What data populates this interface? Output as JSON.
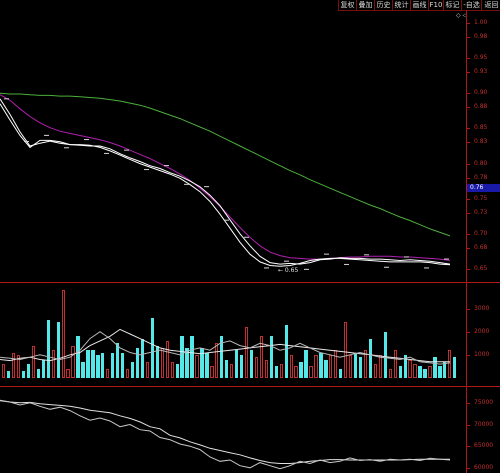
{
  "toolbar": {
    "buttons": [
      "复权",
      "叠加",
      "历史",
      "统计",
      "画线",
      "F10",
      "标记",
      "-自选",
      "返回"
    ]
  },
  "top_right_glyph": "◇ ◁",
  "price_marker": "0.76",
  "low_annotation": "← 0.65",
  "colors": {
    "background": "#000000",
    "frame": "#b01818",
    "up_bar": "#c03030",
    "down_bar": "#54e8e8",
    "ma_long": "#4caf3a",
    "ma_mid": "#b020b0",
    "ma_short": "#ffffff",
    "marker_bg": "#1a1aa8"
  },
  "chart_data": [
    {
      "type": "line",
      "panel": "price",
      "yticks": [
        "1.00",
        "0.98",
        "0.95",
        "0.93",
        "0.90",
        "0.88",
        "0.85",
        "0.83",
        "0.80",
        "0.78",
        "0.75",
        "0.73",
        "0.70",
        "0.68",
        "0.65"
      ],
      "ylim": [
        0.64,
        1.01
      ],
      "x": [
        0,
        10,
        20,
        30,
        40,
        50,
        60,
        70,
        80,
        90,
        100,
        110,
        120,
        130,
        140,
        150,
        160,
        170,
        180,
        190,
        200,
        210,
        220,
        230,
        240,
        250,
        260,
        270,
        280,
        290,
        300,
        310,
        320,
        330,
        340,
        350,
        360,
        370,
        380,
        390,
        400,
        410,
        420,
        430,
        440,
        450
      ],
      "series": [
        {
          "values": [
            0.9,
            0.899,
            0.899,
            0.898,
            0.897,
            0.897,
            0.896,
            0.896,
            0.895,
            0.894,
            0.893,
            0.891,
            0.889,
            0.886,
            0.883,
            0.879,
            0.874,
            0.869,
            0.864,
            0.858,
            0.852,
            0.846,
            0.839,
            0.832,
            0.825,
            0.818,
            0.811,
            0.804,
            0.797,
            0.79,
            0.784,
            0.777,
            0.771,
            0.765,
            0.759,
            0.753,
            0.747,
            0.741,
            0.736,
            0.73,
            0.724,
            0.719,
            0.713,
            0.707,
            0.702,
            0.697
          ]
        },
        {
          "values": [
            0.898,
            0.89,
            0.878,
            0.867,
            0.858,
            0.851,
            0.846,
            0.843,
            0.84,
            0.837,
            0.834,
            0.83,
            0.825,
            0.819,
            0.813,
            0.807,
            0.8,
            0.793,
            0.785,
            0.776,
            0.765,
            0.753,
            0.739,
            0.724,
            0.709,
            0.695,
            0.683,
            0.674,
            0.669,
            0.666,
            0.665,
            0.664,
            0.664,
            0.665,
            0.666,
            0.667,
            0.667,
            0.668,
            0.668,
            0.668,
            0.667,
            0.667,
            0.666,
            0.665,
            0.664,
            0.662
          ]
        },
        {
          "values": [
            0.892,
            0.87,
            0.845,
            0.825,
            0.829,
            0.832,
            0.829,
            0.827,
            0.826,
            0.825,
            0.825,
            0.821,
            0.814,
            0.808,
            0.803,
            0.797,
            0.793,
            0.787,
            0.782,
            0.775,
            0.767,
            0.755,
            0.74,
            0.72,
            0.7,
            0.683,
            0.668,
            0.659,
            0.657,
            0.658,
            0.657,
            0.659,
            0.663,
            0.664,
            0.666,
            0.665,
            0.665,
            0.664,
            0.664,
            0.663,
            0.662,
            0.663,
            0.662,
            0.661,
            0.659,
            0.657
          ]
        },
        {
          "values": [
            0.885,
            0.862,
            0.84,
            0.823,
            0.833,
            0.833,
            0.831,
            0.827,
            0.827,
            0.826,
            0.823,
            0.818,
            0.812,
            0.806,
            0.8,
            0.795,
            0.79,
            0.785,
            0.779,
            0.77,
            0.76,
            0.746,
            0.728,
            0.708,
            0.688,
            0.671,
            0.66,
            0.655,
            0.654,
            0.655,
            0.658,
            0.662,
            0.664,
            0.665,
            0.665,
            0.664,
            0.663,
            0.662,
            0.661,
            0.66,
            0.66,
            0.66,
            0.66,
            0.659,
            0.657,
            0.656
          ]
        }
      ]
    },
    {
      "type": "bar",
      "panel": "volume",
      "yticks": [
        "3000",
        "2000",
        "1000"
      ],
      "ylim": [
        0,
        3800
      ],
      "values": [
        600,
        300,
        1100,
        1000,
        300,
        600,
        1400,
        400,
        800,
        2500,
        1200,
        2400,
        3800,
        400,
        1400,
        1800,
        700,
        1200,
        1200,
        1000,
        1100,
        400,
        1100,
        1500,
        1100,
        400,
        700,
        1300,
        1700,
        700,
        2600,
        1400,
        1300,
        1600,
        700,
        600,
        1800,
        1300,
        1800,
        1000,
        1300,
        1100,
        500,
        1500,
        1800,
        800,
        600,
        1200,
        1000,
        2200,
        1200,
        900,
        1800,
        800,
        1800,
        500,
        600,
        2300,
        1000,
        500,
        700,
        1200,
        500,
        1000,
        1100,
        800,
        1000,
        1200,
        400,
        2400,
        1000,
        1100,
        900,
        1200,
        1700,
        600,
        1000,
        2000,
        400,
        1200,
        500,
        1000,
        800,
        600,
        500,
        400,
        500,
        900,
        500,
        700,
        1200,
        900
      ],
      "up": [
        1,
        0,
        1,
        1,
        0,
        0,
        1,
        0,
        0,
        0,
        1,
        0,
        1,
        1,
        1,
        0,
        0,
        0,
        0,
        0,
        0,
        1,
        0,
        0,
        0,
        1,
        0,
        0,
        0,
        1,
        0,
        0,
        1,
        1,
        1,
        0,
        0,
        0,
        0,
        1,
        0,
        0,
        1,
        1,
        0,
        0,
        1,
        0,
        0,
        1,
        0,
        1,
        1,
        1,
        0,
        0,
        1,
        0,
        1,
        1,
        0,
        0,
        1,
        1,
        0,
        0,
        1,
        1,
        0,
        1,
        1,
        0,
        0,
        1,
        0,
        1,
        1,
        0,
        1,
        1,
        0,
        0,
        1,
        1,
        0,
        0,
        1,
        0,
        0,
        0,
        1,
        0
      ],
      "ma_lines": [
        {
          "values": [
            800,
            750,
            850,
            900,
            800,
            750,
            850,
            1000,
            1100,
            1400,
            1600,
            1800,
            2100,
            1900,
            1700,
            1500,
            1300,
            1200,
            1150,
            1100,
            1050,
            1100,
            1150,
            1200,
            1250,
            1300,
            1350,
            1400,
            1450,
            1400,
            1350,
            1300,
            1250,
            1200,
            1150,
            1100,
            1050,
            1000,
            950,
            900,
            850,
            800,
            750,
            700,
            700,
            700
          ]
        },
        {
          "values": [
            900,
            850,
            800,
            900,
            1000,
            900,
            800,
            900,
            1200,
            1700,
            2000,
            1700,
            1300,
            1100,
            1000,
            1100,
            1200,
            1100,
            1000,
            1200,
            1300,
            1200,
            1500,
            1600,
            1400,
            1300,
            1500,
            1400,
            1200,
            1300,
            1500,
            1300,
            1100,
            1000,
            900,
            1000,
            1100,
            1000,
            900,
            850,
            800,
            900,
            700,
            650,
            600,
            650
          ]
        }
      ]
    },
    {
      "type": "line",
      "panel": "indicator",
      "yticks": [
        "75000",
        "70000",
        "65000",
        "60000"
      ],
      "ylim": [
        59500,
        77500
      ],
      "x": [
        0,
        10,
        20,
        30,
        40,
        50,
        60,
        70,
        80,
        90,
        100,
        110,
        120,
        130,
        140,
        150,
        160,
        170,
        180,
        190,
        200,
        210,
        220,
        230,
        240,
        250,
        260,
        270,
        280,
        290,
        300,
        310,
        320,
        330,
        340,
        350,
        360,
        370,
        380,
        390,
        400,
        410,
        420,
        430,
        440,
        450
      ],
      "series": [
        {
          "values": [
            75500,
            75200,
            75000,
            75100,
            74800,
            74600,
            74400,
            74200,
            73800,
            73300,
            73000,
            72700,
            72000,
            71400,
            70600,
            69500,
            69000,
            67500,
            66900,
            66000,
            65300,
            64500,
            64000,
            63500,
            63000,
            62300,
            61700,
            61200,
            61000,
            61000,
            61200,
            61500,
            61700,
            61900,
            61900,
            61800,
            61800,
            61800,
            61800,
            61800,
            61800,
            61900,
            62000,
            62000,
            62000,
            62000
          ]
        },
        {
          "values": [
            75600,
            75200,
            74500,
            75000,
            74200,
            73500,
            74000,
            73200,
            72000,
            71000,
            71500,
            70800,
            69500,
            70000,
            68800,
            68500,
            67000,
            66500,
            65500,
            65000,
            64200,
            62500,
            61500,
            61800,
            60500,
            60000,
            61200,
            60500,
            59800,
            60500,
            61500,
            61000,
            61800,
            61200,
            61500,
            62300,
            61700,
            61900,
            61500,
            62000,
            61800,
            62000,
            61700,
            62200,
            62000,
            61800
          ]
        }
      ]
    }
  ]
}
